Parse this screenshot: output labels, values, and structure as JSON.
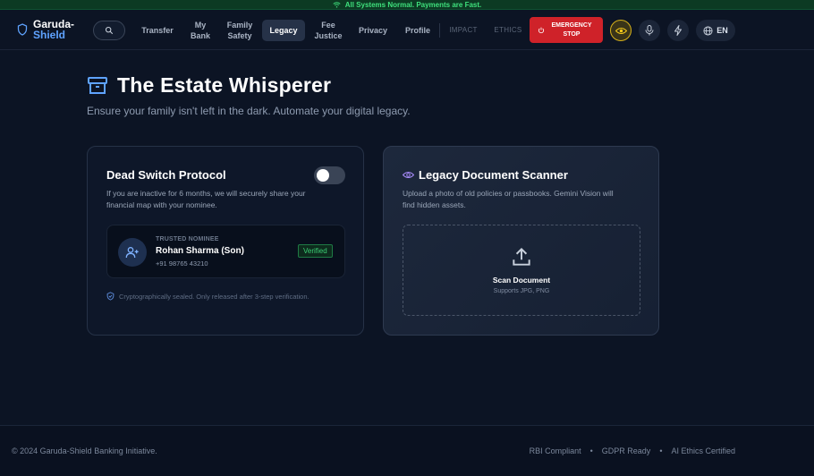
{
  "status_bar": {
    "text": "All Systems Normal. Payments are Fast."
  },
  "brand": {
    "line1": "Garuda-",
    "line2": "Shield"
  },
  "nav": {
    "items": [
      {
        "label": "Transfer"
      },
      {
        "label": "My Bank"
      },
      {
        "label": "Family Safety"
      },
      {
        "label": "Legacy",
        "active": true
      },
      {
        "label": "Fee Justice"
      },
      {
        "label": "Privacy"
      },
      {
        "label": "Profile"
      },
      {
        "label": "IMPACT"
      },
      {
        "label": "ETHICS"
      }
    ],
    "emergency_label": "EMERGENCY STOP",
    "language": "EN"
  },
  "page": {
    "title": "The Estate Whisperer",
    "subtitle": "Ensure your family isn't left in the dark. Automate your digital legacy."
  },
  "dead_switch": {
    "title": "Dead Switch Protocol",
    "description": "If you are inactive for 6 months, we will securely share your financial map with your nominee.",
    "enabled": false,
    "nominee": {
      "label": "TRUSTED NOMINEE",
      "name": "Rohan Sharma (Son)",
      "phone": "+91 98765 43210",
      "badge": "Verified"
    },
    "seal_note": "Cryptographically sealed. Only released after 3-step verification."
  },
  "scanner": {
    "title": "Legacy Document Scanner",
    "description": "Upload a photo of old policies or passbooks. Gemini Vision will find hidden assets.",
    "dropzone_title": "Scan Document",
    "dropzone_sub": "Supports JPG, PNG"
  },
  "footer": {
    "copyright": "© 2024 Garuda-Shield Banking Initiative.",
    "links": [
      "RBI Compliant",
      "GDPR Ready",
      "AI Ethics Certified"
    ]
  },
  "colors": {
    "background": "#0c1424",
    "accent_blue": "#5fa3ff",
    "emergency_red": "#cf2229",
    "status_green": "#3ee07c",
    "verified_green": "#3ccf74",
    "eye_yellow": "#d8b21a",
    "scanner_purple": "#a78bfa"
  }
}
